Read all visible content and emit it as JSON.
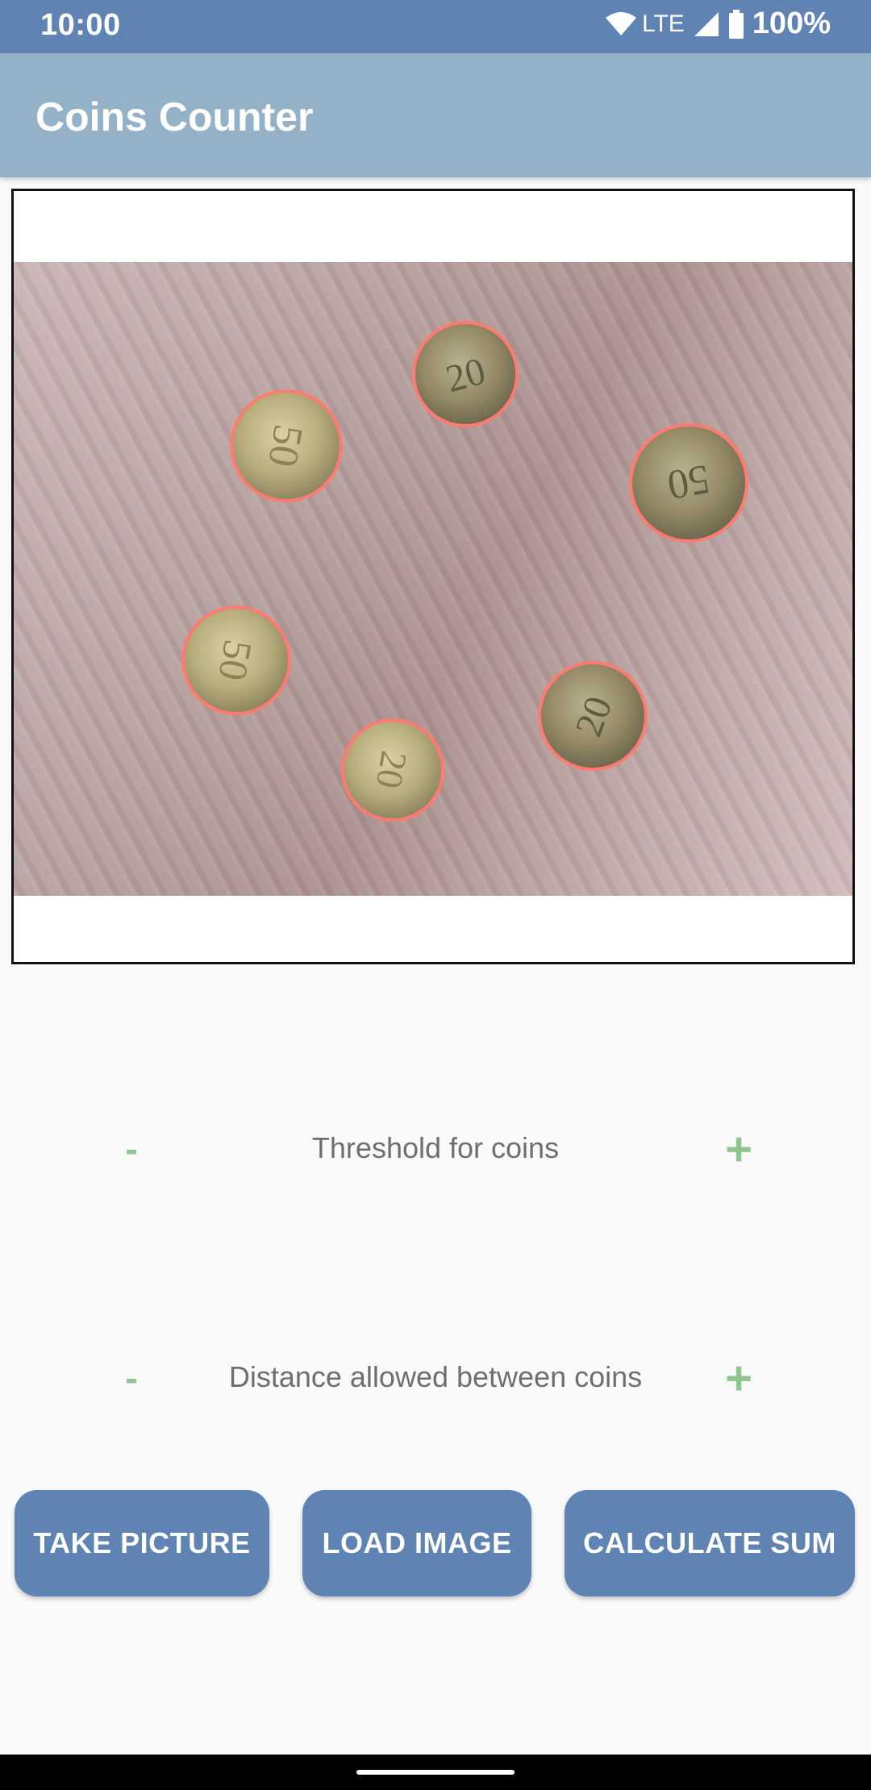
{
  "status_bar": {
    "time": "10:00",
    "network": "LTE",
    "battery": "100%",
    "icons": [
      "wifi-icon",
      "cell-signal-icon",
      "battery-icon"
    ]
  },
  "app_bar": {
    "title": "Coins Counter"
  },
  "image_view": {
    "coins_detected": 6,
    "coin_outline_color": "#ff7b72",
    "coins": [
      {
        "value": "50"
      },
      {
        "value": "20"
      },
      {
        "value": "50"
      },
      {
        "value": "50"
      },
      {
        "value": "20"
      },
      {
        "value": "20"
      }
    ]
  },
  "controls": {
    "threshold": {
      "label": "Threshold for coins",
      "minus": "-",
      "plus": "+"
    },
    "distance": {
      "label": "Distance allowed between coins",
      "minus": "-",
      "plus": "+"
    }
  },
  "buttons": {
    "take_picture": "TAKE PICTURE",
    "load_image": "LOAD IMAGE",
    "calculate_sum": "CALCULATE SUM"
  },
  "colors": {
    "status_bar": "#5f83b2",
    "app_bar": "#93b2c8",
    "button": "#5f83b2",
    "accent_green": "#8fc58f"
  }
}
